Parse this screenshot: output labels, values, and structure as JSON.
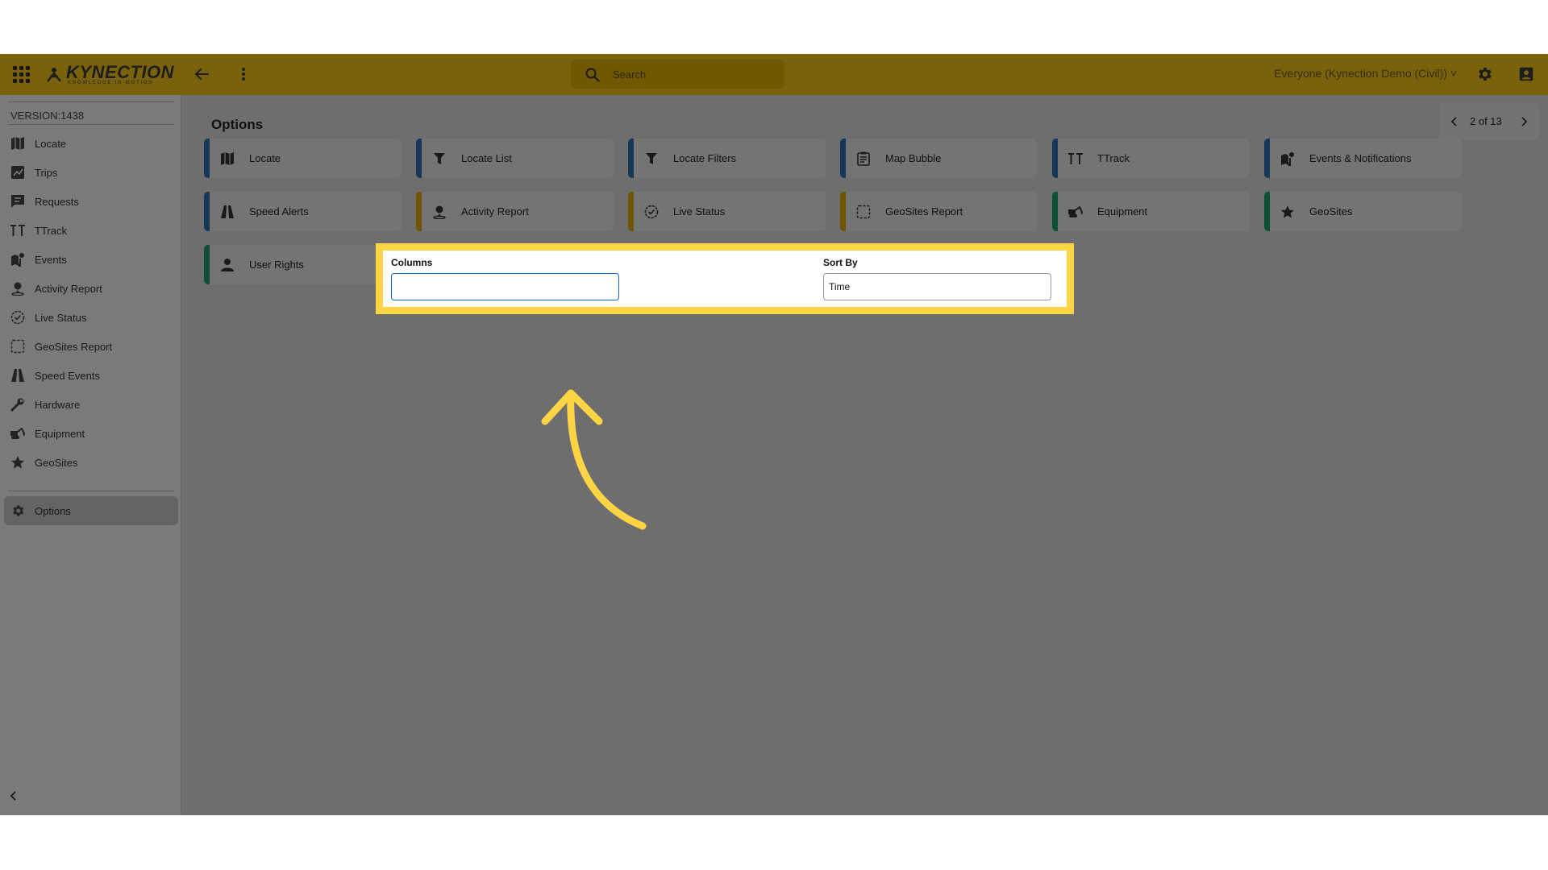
{
  "header": {
    "logo_text": "KYNECTION",
    "logo_tagline": "KNOWLEDGE IN MOTION",
    "search_placeholder": "Search",
    "account_label": "Everyone (Kynection Demo (Civil)) ˅"
  },
  "sidebar": {
    "version": "VERSION:1438",
    "items": [
      {
        "label": "Locate",
        "icon": "map-icon"
      },
      {
        "label": "Trips",
        "icon": "trips-icon"
      },
      {
        "label": "Requests",
        "icon": "requests-icon"
      },
      {
        "label": "TTrack",
        "icon": "ttrack-icon"
      },
      {
        "label": "Events",
        "icon": "events-icon"
      },
      {
        "label": "Activity Report",
        "icon": "person-pin-icon"
      },
      {
        "label": "Live Status",
        "icon": "check-circle-icon"
      },
      {
        "label": "GeoSites Report",
        "icon": "dashed-square-icon"
      },
      {
        "label": "Speed Events",
        "icon": "road-icon"
      },
      {
        "label": "Hardware",
        "icon": "wrench-icon"
      },
      {
        "label": "Equipment",
        "icon": "excavator-icon"
      },
      {
        "label": "GeoSites",
        "icon": "star-icon"
      }
    ],
    "options_label": "Options"
  },
  "main": {
    "title": "Options",
    "pager": "2 of 13",
    "cards": [
      {
        "label": "Locate",
        "icon": "map-icon",
        "color": "#2f6fb0"
      },
      {
        "label": "Locate List",
        "icon": "filter-icon",
        "color": "#2f6fb0"
      },
      {
        "label": "Locate Filters",
        "icon": "filter-icon",
        "color": "#2f6fb0"
      },
      {
        "label": "Map Bubble",
        "icon": "clipboard-icon",
        "color": "#2f6fb0"
      },
      {
        "label": "TTrack",
        "icon": "ttrack-icon",
        "color": "#2f6fb0"
      },
      {
        "label": "Events & Notifications",
        "icon": "events-icon",
        "color": "#2f6fb0"
      },
      {
        "label": "Speed Alerts",
        "icon": "road-icon",
        "color": "#2f6fb0"
      },
      {
        "label": "Activity Report",
        "icon": "person-pin-icon",
        "color": "#e0a800"
      },
      {
        "label": "Live Status",
        "icon": "check-circle-icon",
        "color": "#e0a800"
      },
      {
        "label": "GeoSites Report",
        "icon": "dashed-square-icon",
        "color": "#e0a800"
      },
      {
        "label": "Equipment",
        "icon": "excavator-icon",
        "color": "#1aa06d"
      },
      {
        "label": "GeoSites",
        "icon": "star-icon",
        "color": "#1aa06d"
      },
      {
        "label": "User Rights",
        "icon": "person-icon",
        "color": "#1aa06d"
      }
    ]
  },
  "form": {
    "columns_label": "Columns",
    "columns_value": "",
    "sort_label": "Sort By",
    "sort_value": "Time"
  },
  "colors": {
    "topbar": "#f5c518",
    "highlight": "#fdd444"
  }
}
